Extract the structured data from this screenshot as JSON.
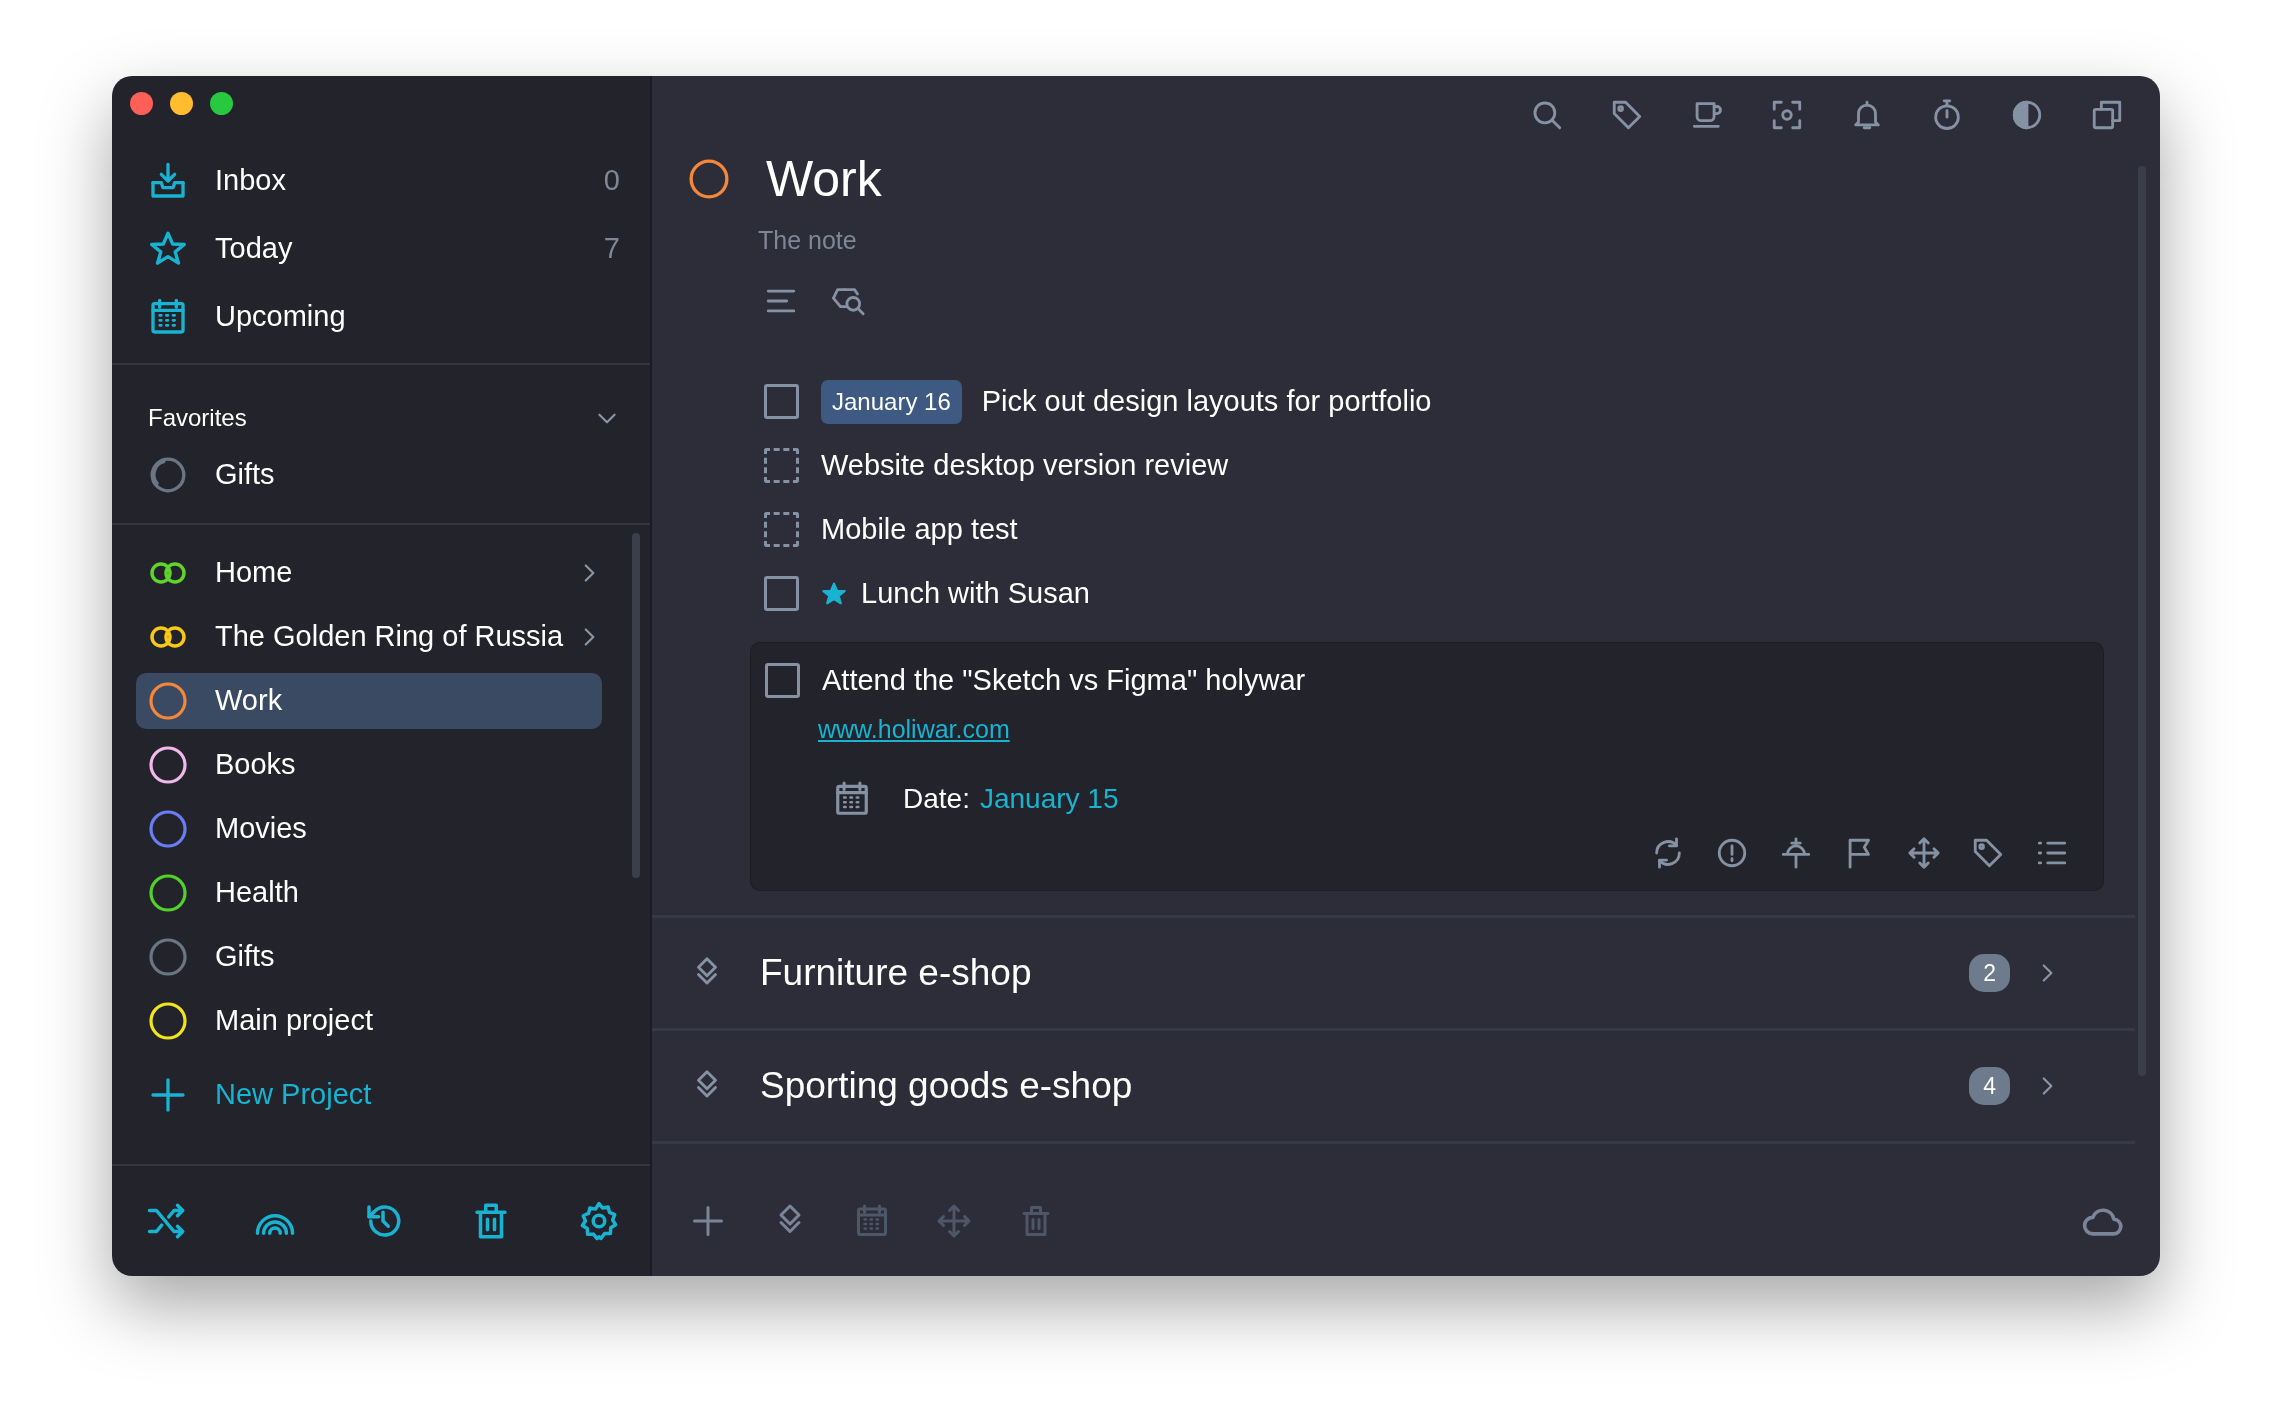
{
  "sidebar": {
    "nav": [
      {
        "label": "Inbox",
        "count": "0"
      },
      {
        "label": "Today",
        "count": "7"
      },
      {
        "label": "Upcoming"
      }
    ],
    "favorites": {
      "title": "Favorites",
      "expanded": true,
      "items": [
        {
          "label": "Gifts"
        }
      ]
    },
    "projects": [
      {
        "kind": "group",
        "label": "Home",
        "color": "#5fd42a",
        "selected": false
      },
      {
        "kind": "group",
        "label": "The Golden Ring of Russia",
        "color": "#f7c815",
        "selected": false
      },
      {
        "kind": "project",
        "label": "Work",
        "color": "#f5873a",
        "selected": true
      },
      {
        "kind": "project",
        "label": "Books",
        "color": "#f2b8ea",
        "selected": false
      },
      {
        "kind": "project",
        "label": "Movies",
        "color": "#6b7df2",
        "selected": false
      },
      {
        "kind": "project",
        "label": "Health",
        "color": "#52d12a",
        "selected": false
      },
      {
        "kind": "project",
        "label": "Gifts",
        "color": "#6b7685",
        "selected": false
      },
      {
        "kind": "project",
        "label": "Main project",
        "color": "#f2e51d",
        "selected": false
      }
    ],
    "new_project": "New Project"
  },
  "main": {
    "title": "Work",
    "color": "#f5873a",
    "note": "The note",
    "tasks": [
      {
        "kind": "task",
        "title": "Pick out design layouts for portfolio",
        "date": "January 16",
        "checked": false,
        "starred": false,
        "expanded": false
      },
      {
        "kind": "checklist",
        "title": "Website desktop version review",
        "checked": false,
        "starred": false,
        "expanded": false
      },
      {
        "kind": "checklist",
        "title": "Mobile app test",
        "checked": false,
        "starred": false,
        "expanded": false
      },
      {
        "kind": "task",
        "title": "Lunch with Susan",
        "checked": false,
        "starred": true,
        "expanded": false
      },
      {
        "kind": "task",
        "title": "Attend the \"Sketch vs Figma\" holywar",
        "checked": false,
        "starred": false,
        "expanded": true,
        "link": "www.holiwar.com",
        "date_label": "Date:",
        "date_value": "January 15"
      }
    ],
    "headings": [
      {
        "title": "Furniture e-shop",
        "count": "2"
      },
      {
        "title": "Sporting goods e-shop",
        "count": "4"
      }
    ]
  }
}
